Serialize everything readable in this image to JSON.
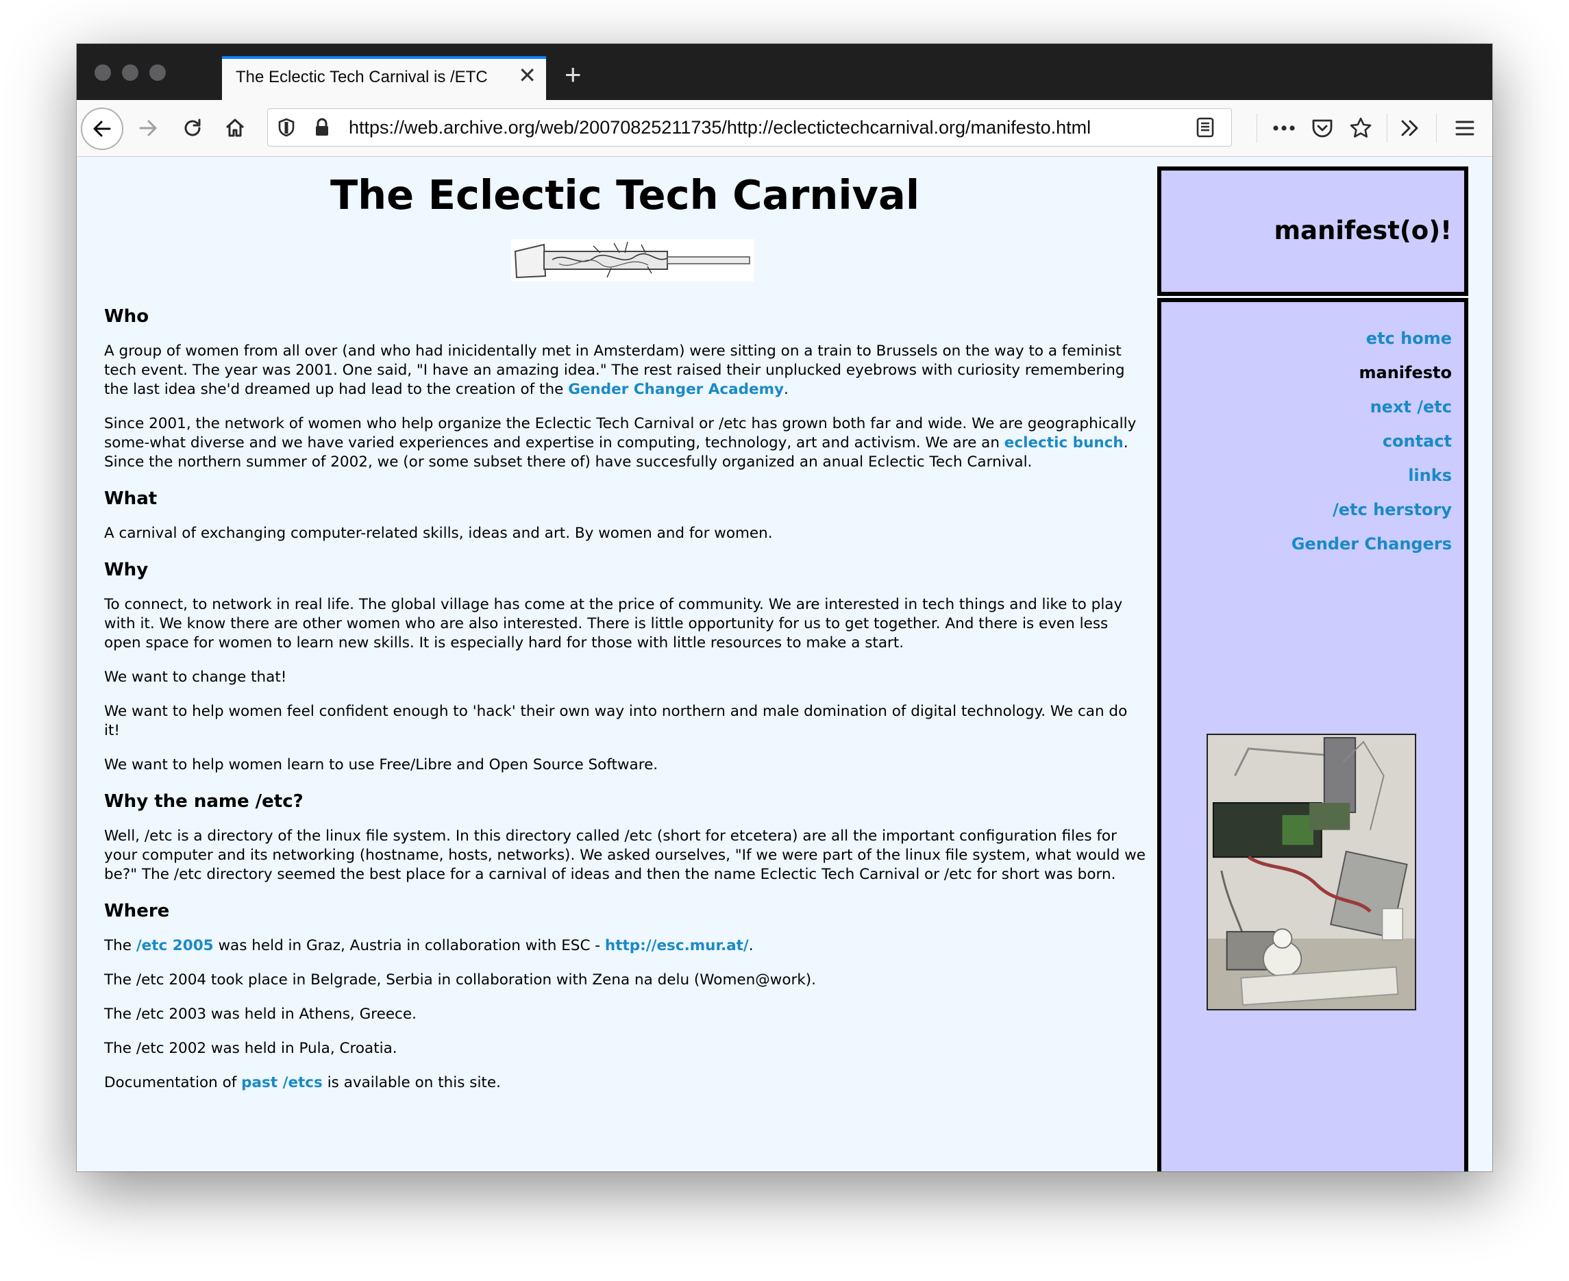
{
  "browser": {
    "tab_title": "The Eclectic Tech Carnival is /ETC",
    "url": "https://web.archive.org/web/20070825211735/http://eclectictechcarnival.org/manifesto.html"
  },
  "page": {
    "title": "The Eclectic Tech Carnival",
    "sections": {
      "who": {
        "heading": "Who",
        "p1_a": "A group of women from all over (and who had inicidentally met in Amsterdam) were sitting on a train to Brussels on the way to a feminist tech event. The year was 2001. One said, \"I have an amazing idea.\" The rest raised their unplucked eyebrows with curiosity remembering the last idea she'd dreamed up had lead to the creation of the ",
        "p1_link": "Gender Changer Academy",
        "p1_b": ".",
        "p2_a": "Since 2001, the network of women who help organize the Eclectic Tech Carnival or /etc has grown both far and wide. We are geographically some-what diverse and we have varied experiences and expertise in computing, technology, art and activism. We are an ",
        "p2_link": "eclectic bunch",
        "p2_b": ". Since the northern summer of 2002, we (or some subset there of) have succesfully organized an anual Eclectic Tech Carnival."
      },
      "what": {
        "heading": "What",
        "p1": "A carnival of exchanging computer-related skills, ideas and art. By women and for women."
      },
      "why": {
        "heading": "Why",
        "p1": "To connect, to network in real life. The global village has come at the price of community. We are interested in tech things and like to play with it. We know there are other women who are also interested. There is little opportunity for us to get together. And there is even less open space for women to learn new skills. It is especially hard for those with little resources to make a start.",
        "p2": "We want to change that!",
        "p3": "We want to help women feel confident enough to 'hack' their own way into northern and male domination of digital technology. We can do it!",
        "p4": "We want to help women learn to use Free/Libre and Open Source Software."
      },
      "name": {
        "heading": "Why the name /etc?",
        "p1": "Well, /etc is a directory of the linux file system. In this directory called /etc (short for etcetera) are all the important configuration files for your computer and its networking (hostname, hosts, networks). We asked ourselves, \"If we were part of the linux file system, what would we be?\" The /etc directory seemed the best place for a carnival of ideas and then the name Eclectic Tech Carnival or /etc for short was born."
      },
      "where": {
        "heading": "Where",
        "p1_a": "The ",
        "p1_link1": "/etc 2005",
        "p1_b": " was held in Graz, Austria in collaboration with ESC - ",
        "p1_link2": "http://esc.mur.at/",
        "p1_c": ".",
        "p2": "The /etc 2004 took place in Belgrade, Serbia in collaboration with Zena na delu (Women@work).",
        "p3": "The /etc 2003 was held in Athens, Greece.",
        "p4": "The /etc 2002 was held in Pula, Croatia.",
        "p5_a": "Documentation of ",
        "p5_link": "past /etcs",
        "p5_b": " is available on this site."
      }
    }
  },
  "sidebar": {
    "title": "manifest(o)!",
    "nav": {
      "home": "etc home",
      "manifesto": "manifesto",
      "next": "next /etc",
      "contact": "contact",
      "links": "links",
      "herstory": "/etc herstory",
      "gender": "Gender Changers"
    }
  },
  "colors": {
    "page_bg": "#eff7ff",
    "sidebar_bg": "#ccccff",
    "link": "#1a8ac6",
    "tab_accent": "#0a84ff"
  },
  "icons": [
    "back-arrow-icon",
    "forward-arrow-icon",
    "reload-icon",
    "home-icon",
    "shield-icon",
    "lock-icon",
    "reader-view-icon",
    "more-icon",
    "pocket-icon",
    "bookmark-star-icon",
    "overflow-chevrons-icon",
    "hamburger-menu-icon",
    "close-icon",
    "plus-icon"
  ]
}
